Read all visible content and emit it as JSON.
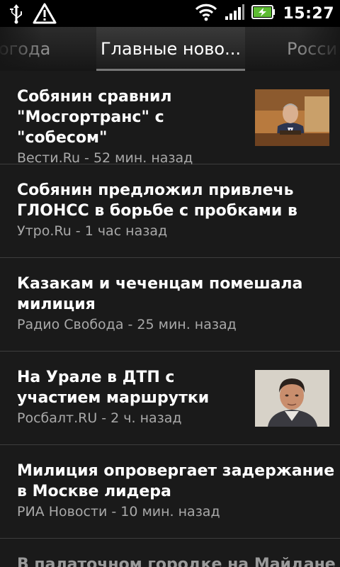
{
  "status_bar": {
    "time": "15:27",
    "icons": [
      "usb-icon",
      "warning-icon",
      "wifi-icon",
      "signal-icon",
      "battery-charging-icon"
    ]
  },
  "tabs": {
    "left_label": "огода",
    "active_label": "Главные ново...",
    "right_label": "Росси"
  },
  "news": [
    {
      "title": "Собянин сравнил \"Мосгортранс\" с \"собесом\"",
      "meta": "Вести.Ru - 52 мин. назад",
      "thumbnail": "politician-at-podium"
    },
    {
      "title": "Собянин предложил привлечь ГЛОНСС в борьбе с пробками в",
      "meta": "Утро.Ru - 1 час назад"
    },
    {
      "title": "Казакам и чеченцам помешала милиция",
      "meta": "Радио Свобода - 25 мин. назад"
    },
    {
      "title": "На Урале в ДТП с участием маршрутки",
      "meta": "Росбалт.RU - 2 ч. назад",
      "thumbnail": "man-portrait"
    },
    {
      "title": "Милиция опровергает задержание в Москве лидера",
      "meta": "РИА Новости - 10 мин. назад"
    },
    {
      "title": "В палаточном городке на Майдане"
    }
  ],
  "colors": {
    "background": "#1a1a1a",
    "title_text": "#ffffff",
    "meta_text": "#a9a9a9",
    "divider": "#3d3d3d",
    "battery_fill": "#5dbb32"
  }
}
